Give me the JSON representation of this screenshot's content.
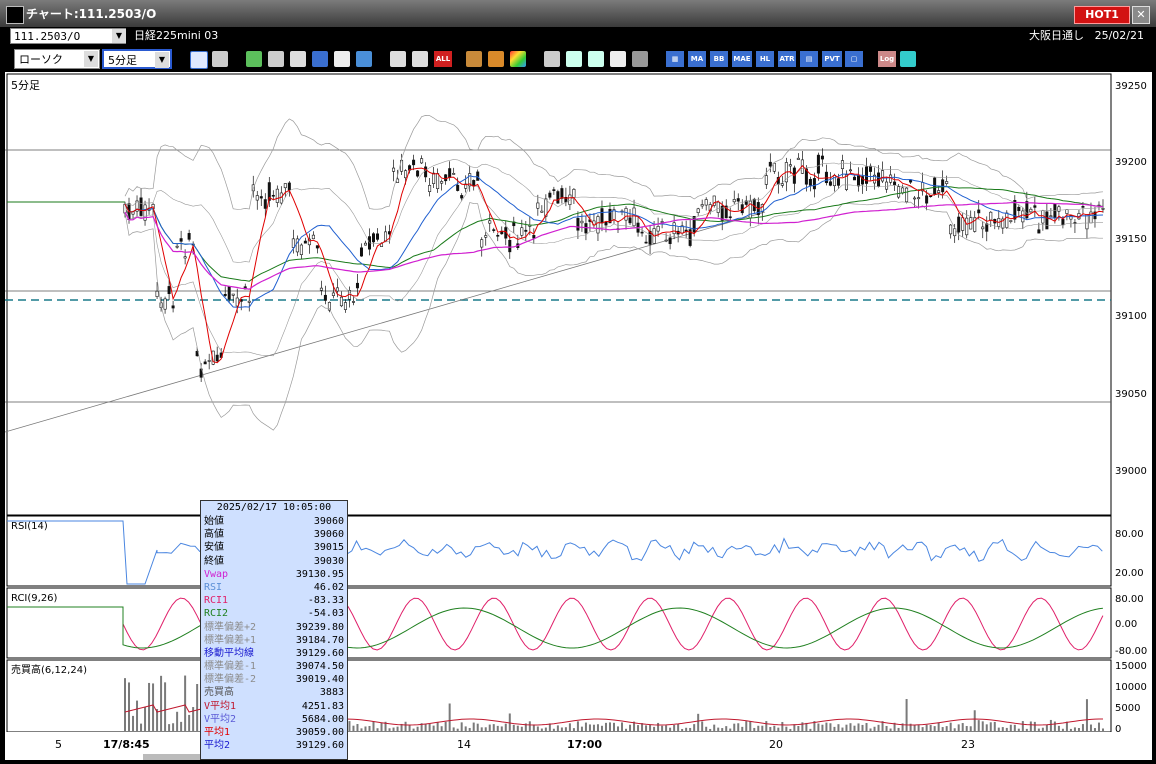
{
  "window": {
    "title": "チャート:111.2503/O",
    "hot_label": "HOT1",
    "close_glyph": "✕"
  },
  "header": {
    "symbol": "111.2503/O",
    "instrument": "日経225mini 03",
    "market": "大阪日通し",
    "date": "25/02/21"
  },
  "toolbar": {
    "chart_type": "ローソク",
    "timeframe": "5分足",
    "labels": {
      "all": "ALL",
      "ma": "MA",
      "bb": "BB",
      "mae": "MAE",
      "hl": "HL",
      "atr": "ATR",
      "pvt": "PVT",
      "log": "Log"
    }
  },
  "price_panel": {
    "label": "5分足",
    "ticks": [
      "39250",
      "39200",
      "39150",
      "39100",
      "39050",
      "39000"
    ]
  },
  "rsi_panel": {
    "label": "RSI(14)",
    "ticks": [
      "80.00",
      "20.00"
    ]
  },
  "rci_panel": {
    "label": "RCI(9,26)",
    "ticks": [
      "80.00",
      "0.00",
      "-80.00"
    ]
  },
  "volume_panel": {
    "label": "売買高(6,12,24)",
    "ticks": [
      "15000",
      "10000",
      "5000",
      "0"
    ]
  },
  "time_axis": [
    "5",
    "17/8:45",
    "14",
    "17:00",
    "20",
    "23"
  ],
  "tooltip": {
    "date": "2025/02/17 10:05:00",
    "rows": [
      {
        "label": "始値",
        "value": "39060",
        "color": "#000000"
      },
      {
        "label": "高値",
        "value": "39060",
        "color": "#000000"
      },
      {
        "label": "安値",
        "value": "39015",
        "color": "#000000"
      },
      {
        "label": "終値",
        "value": "39030",
        "color": "#000000"
      },
      {
        "label": "Vwap",
        "value": "39130.95",
        "color": "#d020d0"
      },
      {
        "label": "RSI",
        "value": "46.02",
        "color": "#5b8fd6"
      },
      {
        "label": "RCI1",
        "value": "-83.33",
        "color": "#e0206a"
      },
      {
        "label": "RCI2",
        "value": "-54.03",
        "color": "#208020"
      },
      {
        "label": "標準偏差+2",
        "value": "39239.80",
        "color": "#8c8c8c"
      },
      {
        "label": "標準偏差+1",
        "value": "39184.70",
        "color": "#8c8c8c"
      },
      {
        "label": "移動平均線",
        "value": "39129.60",
        "color": "#1b1bd0"
      },
      {
        "label": "標準偏差-1",
        "value": "39074.50",
        "color": "#8c8c8c"
      },
      {
        "label": "標準偏差-2",
        "value": "39019.40",
        "color": "#8c8c8c"
      },
      {
        "label": "売買高",
        "value": "3883",
        "color": "#555555"
      },
      {
        "label": "V平均1",
        "value": "4251.83",
        "color": "#c0182e"
      },
      {
        "label": "V平均2",
        "value": "5684.00",
        "color": "#5b5bd6"
      },
      {
        "label": "平均1",
        "value": "39059.00",
        "color": "#e00000"
      },
      {
        "label": "平均2",
        "value": "39129.60",
        "color": "#1b1bd0"
      }
    ]
  },
  "colors": {
    "ma_red": "#e00000",
    "ma_blue": "#1f5fd0",
    "ma_green": "#1a7a1a",
    "vwap": "#d020d0",
    "band": "#9a9a9a",
    "rsi": "#4a86e0",
    "rci1": "#e0206a",
    "rci2": "#208020"
  }
}
